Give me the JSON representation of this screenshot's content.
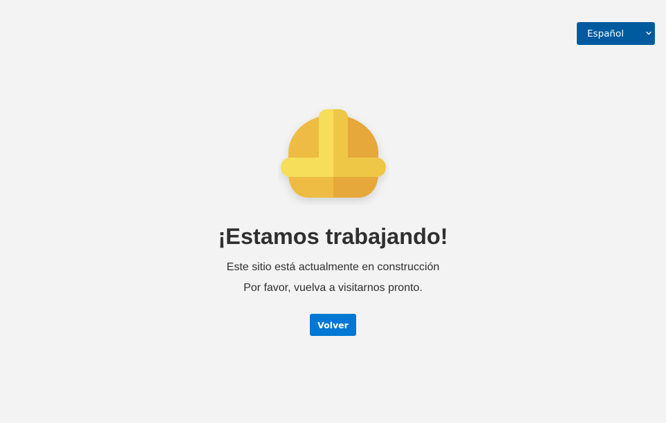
{
  "language_selector": {
    "selected": "Español",
    "accent_color": "#005a9e",
    "icon": "chevron-down-icon"
  },
  "illustration": {
    "icon": "hard-hat-icon"
  },
  "main": {
    "title": "¡Estamos trabajando!",
    "message_line1": "Este sitio está actualmente en construcción",
    "message_line2": "Por favor, vuelva a visitarnos pronto."
  },
  "actions": {
    "back_label": "Volver",
    "back_color": "#0078d4"
  }
}
